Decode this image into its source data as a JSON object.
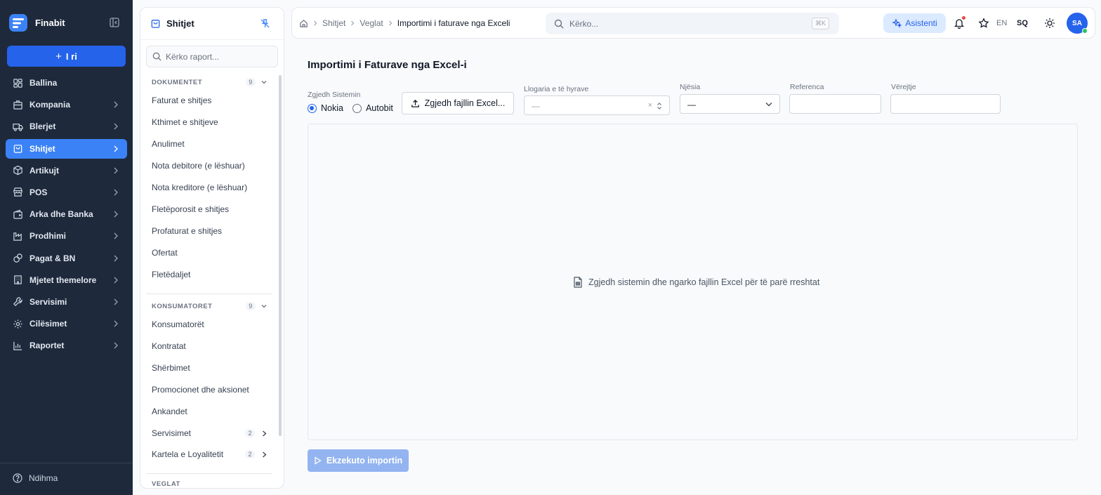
{
  "app": {
    "name": "Finabit"
  },
  "nav": {
    "new_label": "I ri",
    "items": [
      {
        "label": "Ballina",
        "icon": "dashboard-icon",
        "has_children": false,
        "active": false
      },
      {
        "label": "Kompania",
        "icon": "building-icon",
        "has_children": true,
        "active": false
      },
      {
        "label": "Blerjet",
        "icon": "truck-icon",
        "has_children": true,
        "active": false
      },
      {
        "label": "Shitjet",
        "icon": "shopping-bag-icon",
        "has_children": true,
        "active": true
      },
      {
        "label": "Artikujt",
        "icon": "box-icon",
        "has_children": true,
        "active": false
      },
      {
        "label": "POS",
        "icon": "store-icon",
        "has_children": true,
        "active": false
      },
      {
        "label": "Arka dhe Banka",
        "icon": "wallet-icon",
        "has_children": true,
        "active": false
      },
      {
        "label": "Prodhimi",
        "icon": "factory-icon",
        "has_children": true,
        "active": false
      },
      {
        "label": "Pagat & BN",
        "icon": "coins-icon",
        "has_children": true,
        "active": false
      },
      {
        "label": "Mjetet themelore",
        "icon": "office-building-icon",
        "has_children": true,
        "active": false
      },
      {
        "label": "Servisimi",
        "icon": "wrench-icon",
        "has_children": true,
        "active": false
      },
      {
        "label": "Cilësimet",
        "icon": "gear-icon",
        "has_children": true,
        "active": false
      },
      {
        "label": "Raportet",
        "icon": "bar-chart-icon",
        "has_children": true,
        "active": false
      }
    ],
    "help_label": "Ndihma"
  },
  "panel": {
    "title": "Shitjet",
    "search_placeholder": "Kërko raport...",
    "sections": [
      {
        "title": "DOKUMENTET",
        "count": "9",
        "items": [
          {
            "label": "Faturat e shitjes"
          },
          {
            "label": "Kthimet e shitjeve"
          },
          {
            "label": "Anulimet"
          },
          {
            "label": "Nota debitore (e lëshuar)"
          },
          {
            "label": "Nota kreditore (e lëshuar)"
          },
          {
            "label": "Fletëporosit e shitjes"
          },
          {
            "label": "Profaturat e shitjes"
          },
          {
            "label": "Ofertat"
          },
          {
            "label": "Fletëdaljet"
          }
        ]
      },
      {
        "title": "KONSUMATORET",
        "count": "9",
        "items": [
          {
            "label": "Konsumatorët"
          },
          {
            "label": "Kontratat"
          },
          {
            "label": "Shërbimet"
          },
          {
            "label": "Promocionet dhe aksionet"
          },
          {
            "label": "Ankandet"
          },
          {
            "label": "Servisimet",
            "count": "2"
          },
          {
            "label": "Kartela e Loyalitetit",
            "count": "2"
          }
        ]
      },
      {
        "title": "VEGLAT"
      }
    ]
  },
  "topbar": {
    "breadcrumb": [
      "Shitjet",
      "Veglat",
      "Importimi i faturave nga Exceli"
    ],
    "search_placeholder": "Kërko...",
    "search_shortcut": "⌘K",
    "assistant_label": "Asistenti",
    "lang_en": "EN",
    "lang_sq": "SQ",
    "avatar_initials": "SA"
  },
  "main": {
    "title": "Importimi i Faturave nga Excel-i",
    "system_label": "Zgjedh Sistemin",
    "system_options": [
      "Nokia",
      "Autobit"
    ],
    "system_selected": "Nokia",
    "upload_label": "Zgjedh fajllin Excel...",
    "account_label": "Llogaria e të hyrave",
    "account_value": "—",
    "unit_label": "Njësia",
    "unit_value": "—",
    "reference_label": "Referenca",
    "reference_value": "",
    "note_label": "Vërejtje",
    "note_value": "",
    "empty_message": "Zgjedh sistemin dhe ngarko fajllin Excel për të parë rreshtat",
    "execute_label": "Ekzekuto importin"
  },
  "colors": {
    "sidebar_bg": "#1e293b",
    "accent": "#2563eb",
    "active_nav": "#3b82f6",
    "disabled_button": "#93b4f0"
  }
}
